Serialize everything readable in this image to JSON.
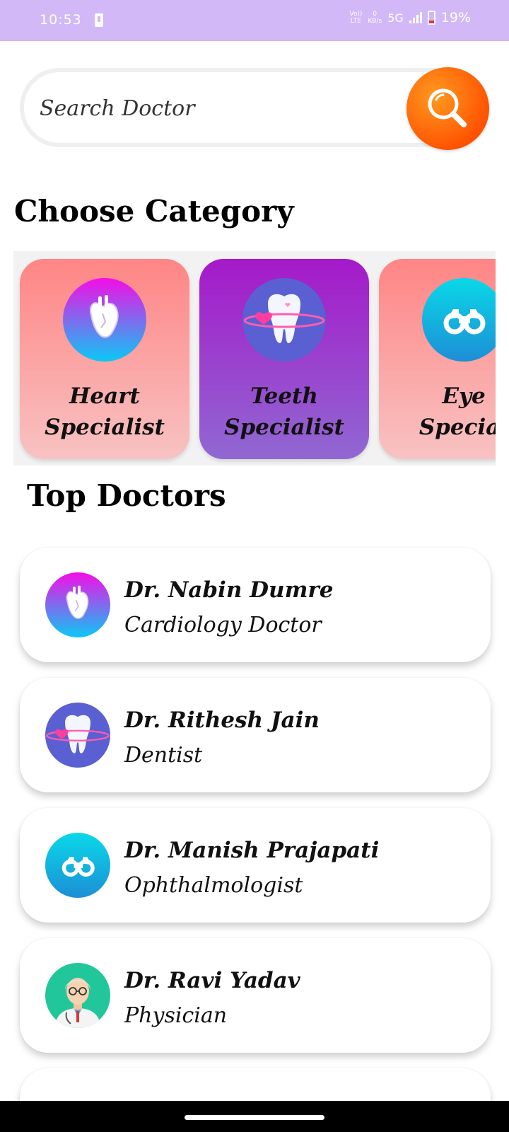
{
  "status_bar": {
    "time": "10:53",
    "volte": "Vo)) LTE",
    "speed_value": "0",
    "speed_unit": "KB/s",
    "network": "5G",
    "battery_percent": "19%"
  },
  "search": {
    "placeholder": "Search Doctor",
    "button_icon": "search-icon",
    "button_color": "#ff6a00"
  },
  "categories": {
    "title": "Choose Category",
    "items": [
      {
        "line1": "Heart",
        "line2": "Specialist",
        "icon": "heart-organ-icon"
      },
      {
        "line1": "Teeth",
        "line2": "Specialist",
        "icon": "tooth-icon"
      },
      {
        "line1": "Eye",
        "line2": "Special",
        "icon": "binoculars-icon"
      }
    ]
  },
  "top_doctors": {
    "title": "Top Doctors",
    "items": [
      {
        "name": "Dr. Nabin Dumre",
        "specialty": "Cardiology Doctor",
        "icon": "heart-organ-icon"
      },
      {
        "name": "Dr. Rithesh Jain",
        "specialty": "Dentist",
        "icon": "tooth-icon"
      },
      {
        "name": "Dr. Manish Prajapati",
        "specialty": "Ophthalmologist",
        "icon": "binoculars-icon"
      },
      {
        "name": "Dr. Ravi Yadav",
        "specialty": "Physician",
        "icon": "doctor-avatar-icon"
      }
    ]
  },
  "colors": {
    "status_bar": "#d2b8f7",
    "card_pink": "#ff8585",
    "card_purple": "#a519c9",
    "accent_orange": "#ff6a00"
  }
}
